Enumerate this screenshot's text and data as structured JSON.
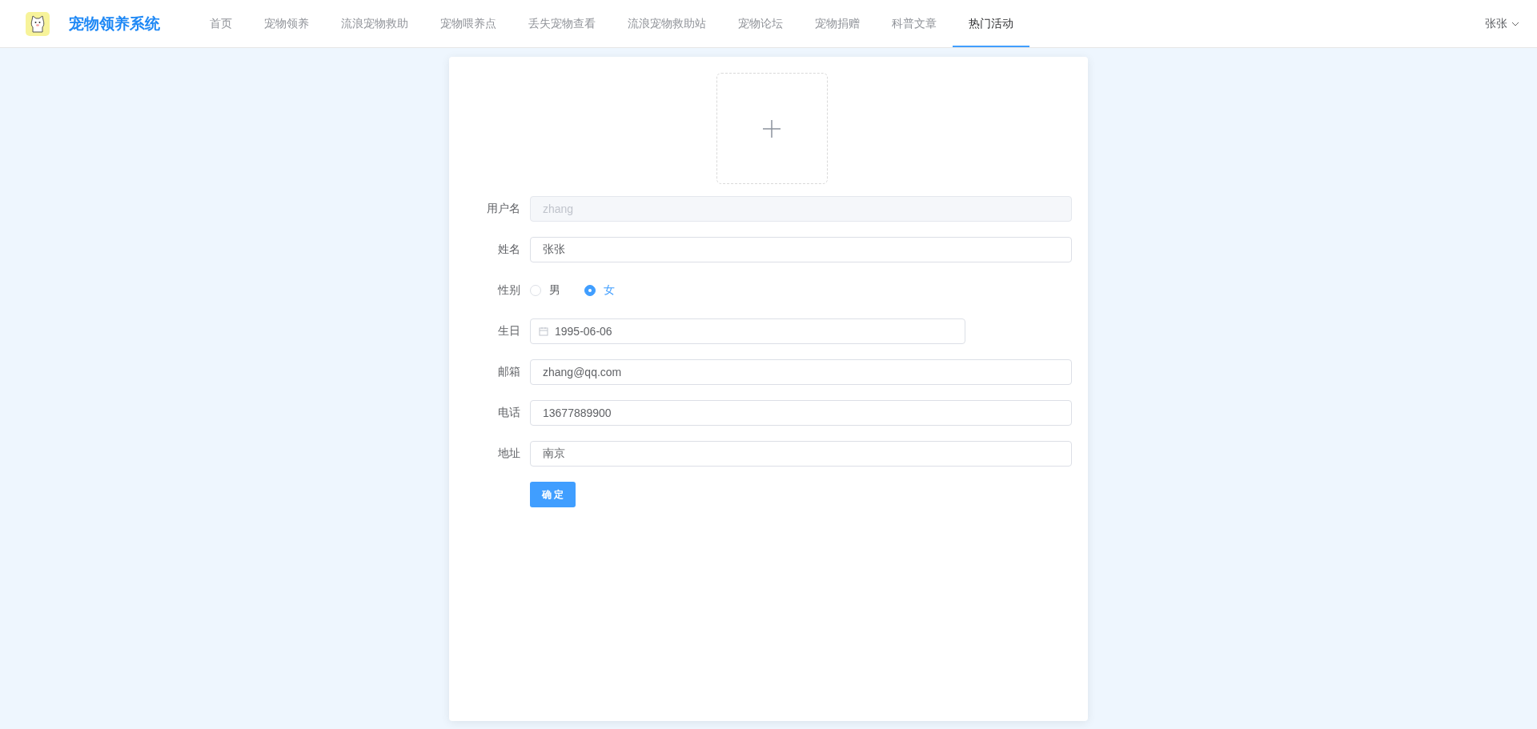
{
  "header": {
    "title": "宠物领养系统",
    "nav": [
      {
        "label": "首页",
        "selected": false
      },
      {
        "label": "宠物领养",
        "selected": false
      },
      {
        "label": "流浪宠物救助",
        "selected": false
      },
      {
        "label": "宠物喂养点",
        "selected": false
      },
      {
        "label": "丢失宠物查看",
        "selected": false
      },
      {
        "label": "流浪宠物救助站",
        "selected": false
      },
      {
        "label": "宠物论坛",
        "selected": false
      },
      {
        "label": "宠物捐赠",
        "selected": false
      },
      {
        "label": "科普文章",
        "selected": false
      },
      {
        "label": "热门活动",
        "selected": true
      }
    ],
    "user": "张张"
  },
  "form": {
    "fields": [
      {
        "kind": "text",
        "label": "用户名",
        "value": "zhang",
        "disabled": true
      },
      {
        "kind": "text",
        "label": "姓名",
        "value": "张张",
        "disabled": false
      },
      {
        "kind": "radio",
        "label": "性别",
        "options": [
          {
            "label": "男",
            "selected": false
          },
          {
            "label": "女",
            "selected": true
          }
        ]
      },
      {
        "kind": "date",
        "label": "生日",
        "value": "1995-06-06"
      },
      {
        "kind": "text",
        "label": "邮箱",
        "value": "zhang@qq.com",
        "disabled": false
      },
      {
        "kind": "text",
        "label": "电话",
        "value": "13677889900",
        "disabled": false
      },
      {
        "kind": "text",
        "label": "地址",
        "value": "南京",
        "disabled": false
      }
    ],
    "submit": "确 定"
  }
}
